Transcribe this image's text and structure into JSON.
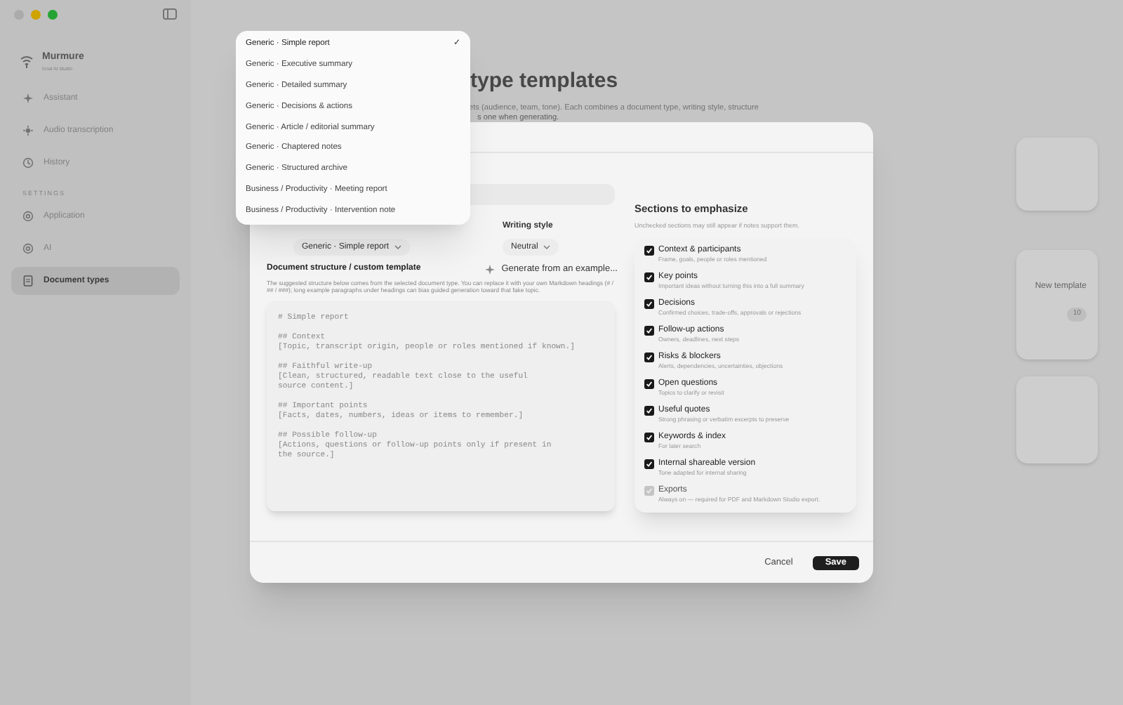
{
  "app": {
    "name": "Murmure",
    "tagline": "local AI studio"
  },
  "sidebar": {
    "items": [
      {
        "label": "Assistant",
        "selected": false
      },
      {
        "label": "Audio transcription",
        "selected": false
      },
      {
        "label": "History",
        "selected": false
      }
    ],
    "section_label": "SETTINGS",
    "settings_items": [
      {
        "label": "Application",
        "selected": false
      },
      {
        "label": "AI",
        "selected": false
      },
      {
        "label": "Document types",
        "selected": true
      }
    ]
  },
  "page": {
    "title": "type templates",
    "description": [
      "ets (audience, team, tone). Each combines a document type, writing style, structure",
      "s one when generating."
    ],
    "new_template": "New template",
    "count_badge": "10"
  },
  "dialog": {
    "writing_style_label": "Writing style",
    "document_type_value": "Generic · Simple report",
    "writing_style_value": "Neutral",
    "structure_title": "Document structure / custom template",
    "generate_button": "Generate from an example...",
    "structure_help": "The suggested structure below comes from the selected document type. You can replace it with your own Markdown headings (# / ## / ###); long example paragraphs under headings can bias guided generation toward that fake topic.",
    "template": "# Simple report\n\n## Context\n[Topic, transcript origin, people or roles mentioned if known.]\n\n## Faithful write-up\n[Clean, structured, readable text close to the useful\nsource content.]\n\n## Important points\n[Facts, dates, numbers, ideas or items to remember.]\n\n## Possible follow-up\n[Actions, questions or follow-up points only if present in\nthe source.]",
    "sections_title": "Sections to emphasize",
    "sections_hint": "Unchecked sections may still appear if notes support them.",
    "sections": [
      {
        "label": "Context & participants",
        "description": "Frame, goals, people or roles mentioned",
        "checked": true,
        "disabled": false
      },
      {
        "label": "Key points",
        "description": "Important ideas without turning this into a full summary",
        "checked": true,
        "disabled": false
      },
      {
        "label": "Decisions",
        "description": "Confirmed choices, trade-offs, approvals or rejections",
        "checked": true,
        "disabled": false
      },
      {
        "label": "Follow-up actions",
        "description": "Owners, deadlines, next steps",
        "checked": true,
        "disabled": false
      },
      {
        "label": "Risks & blockers",
        "description": "Alerts, dependencies, uncertainties, objections",
        "checked": true,
        "disabled": false
      },
      {
        "label": "Open questions",
        "description": "Topics to clarify or revisit",
        "checked": true,
        "disabled": false
      },
      {
        "label": "Useful quotes",
        "description": "Strong phrasing or verbatim excerpts to preserve",
        "checked": true,
        "disabled": false
      },
      {
        "label": "Keywords & index",
        "description": "For later search",
        "checked": true,
        "disabled": false
      },
      {
        "label": "Internal shareable version",
        "description": "Tone adapted for internal sharing",
        "checked": true,
        "disabled": false
      },
      {
        "label": "Exports",
        "description": "Always on — required for PDF and Markdown Studio export.",
        "checked": true,
        "disabled": true
      }
    ],
    "buttons": {
      "cancel": "Cancel",
      "save": "Save"
    }
  },
  "dropdown": {
    "options": [
      {
        "label": "Generic · Simple report",
        "selected": true
      },
      {
        "label": "Generic · Executive summary",
        "selected": false
      },
      {
        "label": "Generic · Detailed summary",
        "selected": false
      },
      {
        "label": "Generic · Decisions & actions",
        "selected": false
      },
      {
        "label": "Generic · Article / editorial summary",
        "selected": false
      },
      {
        "label": "Generic · Chaptered notes",
        "selected": false
      },
      {
        "label": "Generic · Structured archive",
        "selected": false
      },
      {
        "label": "Business / Productivity · Meeting report",
        "selected": false
      },
      {
        "label": "Business / Productivity · Intervention note",
        "selected": false
      }
    ],
    "check_mark": "✓"
  }
}
